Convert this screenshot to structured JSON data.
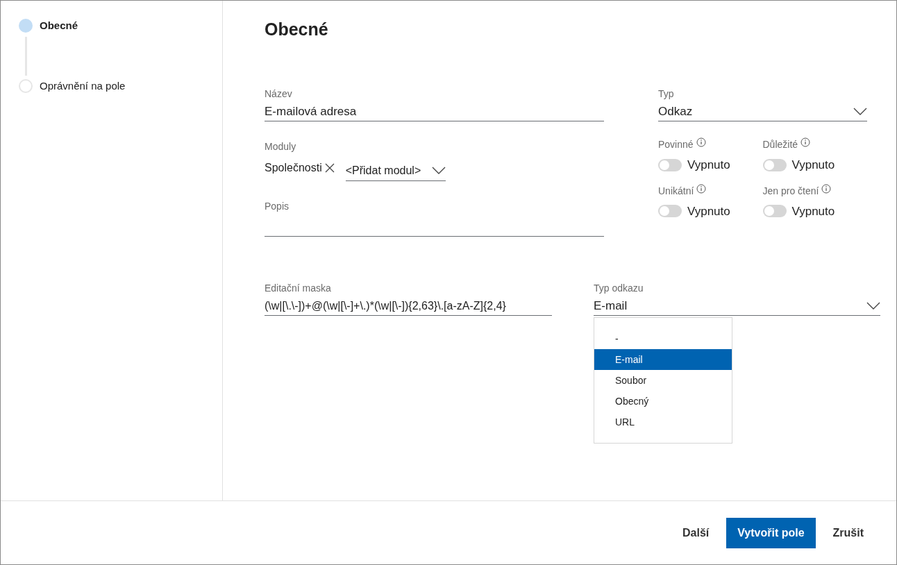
{
  "steps": [
    {
      "label": "Obecné",
      "selected": true
    },
    {
      "label": "Oprávnění na pole",
      "selected": false
    }
  ],
  "heading": "Obecné",
  "name_field": {
    "label": "Název",
    "value": "E-mailová adresa"
  },
  "modules": {
    "label": "Moduly",
    "chips": [
      "Společnosti"
    ],
    "add_placeholder": "<Přidat modul>"
  },
  "description": {
    "label": "Popis"
  },
  "type_field": {
    "label": "Typ",
    "value": "Odkaz"
  },
  "toggles": [
    {
      "label": "Povinné",
      "on": false,
      "state_text": "Vypnuto"
    },
    {
      "label": "Důležité",
      "on": false,
      "state_text": "Vypnuto"
    },
    {
      "label": "Unikátní",
      "on": false,
      "state_text": "Vypnuto"
    },
    {
      "label": "Jen pro čtení",
      "on": false,
      "state_text": "Vypnuto"
    }
  ],
  "mask": {
    "label": "Editační maska",
    "value": "(\\w|[\\.\\-])+@(\\w|[\\-]+\\.)*(\\w|[\\-]){2,63}\\.[a-zA-Z]{2,4}"
  },
  "link_type": {
    "label": "Typ odkazu",
    "value": "E-mail",
    "expanded": true,
    "options": [
      {
        "label": "-",
        "selected": false
      },
      {
        "label": "E-mail",
        "selected": true
      },
      {
        "label": "Soubor",
        "selected": false
      },
      {
        "label": "Obecný",
        "selected": false
      },
      {
        "label": "URL",
        "selected": false
      }
    ]
  },
  "buttons": [
    {
      "label": "Další",
      "kind": "link"
    },
    {
      "label": "Vytvořit pole",
      "kind": "primary"
    },
    {
      "label": "Zrušit",
      "kind": "link"
    }
  ]
}
